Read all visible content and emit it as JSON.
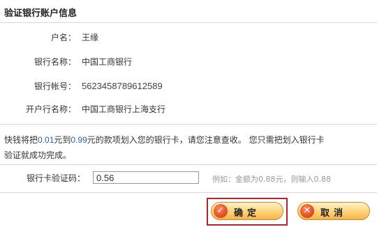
{
  "header": {
    "title": "验证银行账户信息"
  },
  "account": {
    "holder_label": "户名：",
    "holder_value": "王缘",
    "bank_label": "银行名称：",
    "bank_value": "中国工商银行",
    "account_label": "银行帐号：",
    "account_value": "5623458789612589",
    "branch_label": "开户行名称：",
    "branch_value": "中国工商银行上海支行"
  },
  "notice": {
    "part1": "快钱将把",
    "amount_min": "0.01",
    "part2": "元到",
    "amount_max": "0.99",
    "part3": "元的款项划入您的银行卡，请您注意查收。 您只需把划入银行卡",
    "line2": "验证就成功完成。"
  },
  "verify": {
    "label": "银行卡验证码：",
    "value": "0.56",
    "hint": "例如：金额为0.88元，则输入0.88"
  },
  "buttons": {
    "confirm_label": "确定",
    "cancel_label": "取消"
  },
  "colors": {
    "frame": "#b0252d",
    "button": "#ffd27a",
    "icon": "#e0461c"
  }
}
